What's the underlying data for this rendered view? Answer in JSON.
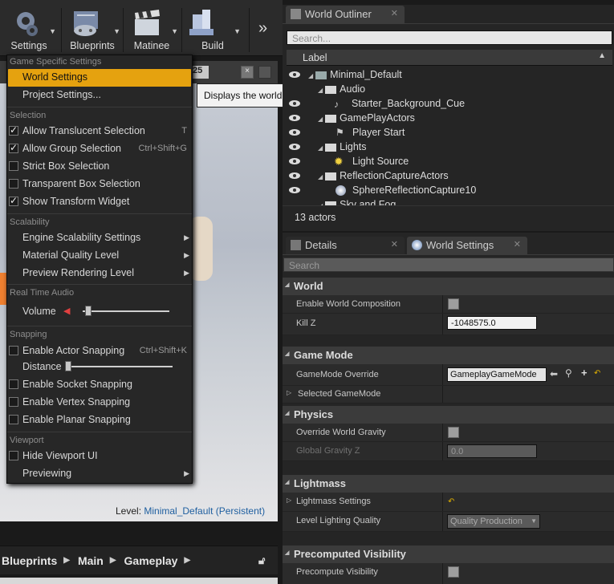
{
  "toolbar": {
    "settings_label": "Settings",
    "blueprints_label": "Blueprints",
    "matinee_label": "Matinee",
    "build_label": "Build",
    "more": "»"
  },
  "viewport": {
    "tab_num": "25",
    "level_label": "Level:",
    "level_value": "Minimal_Default (Persistent)"
  },
  "menu": {
    "section_game": "Game Specific Settings",
    "world_settings": "World Settings",
    "project_settings": "Project Settings...",
    "section_selection": "Selection",
    "allow_translucent": "Allow Translucent Selection",
    "allow_translucent_shortcut": "T",
    "allow_group": "Allow Group Selection",
    "allow_group_shortcut": "Ctrl+Shift+G",
    "strict_box": "Strict Box Selection",
    "transparent_box": "Transparent Box Selection",
    "show_transform": "Show Transform Widget",
    "section_scalability": "Scalability",
    "engine_scalability": "Engine Scalability Settings",
    "material_quality": "Material Quality Level",
    "preview_rendering": "Preview Rendering Level",
    "section_audio": "Real Time Audio",
    "volume": "Volume",
    "volume_level": 0.03,
    "section_snapping": "Snapping",
    "actor_snapping": "Enable Actor Snapping",
    "actor_snapping_shortcut": "Ctrl+Shift+K",
    "distance": "Distance",
    "distance_level": 0.0,
    "socket_snapping": "Enable Socket Snapping",
    "vertex_snapping": "Enable Vertex Snapping",
    "planar_snapping": "Enable Planar Snapping",
    "section_viewport": "Viewport",
    "hide_viewport_ui": "Hide Viewport UI",
    "previewing": "Previewing"
  },
  "tooltip": "Displays the world settings",
  "outliner": {
    "tab": "World Outliner",
    "search_placeholder": "Search...",
    "column_label": "Label",
    "rows": [
      "Minimal_Default",
      "Audio",
      "Starter_Background_Cue",
      "GamePlayActors",
      "Player Start",
      "Lights",
      "Light Source",
      "ReflectionCaptureActors",
      "SphereReflectionCapture10",
      "Sky and Fog"
    ],
    "actor_count": "13 actors"
  },
  "details": {
    "tab_details": "Details",
    "tab_world_settings": "World Settings",
    "search_placeholder": "Search",
    "cat_world": "World",
    "enable_world_composition": "Enable World Composition",
    "kill_z": "Kill Z",
    "kill_z_value": "-1048575.0",
    "cat_game_mode": "Game Mode",
    "gamemode_override": "GameMode Override",
    "gamemode_value": "GameplayGameMode",
    "selected_gamemode": "Selected GameMode",
    "cat_physics": "Physics",
    "override_gravity": "Override World Gravity",
    "global_gravity_z": "Global Gravity Z",
    "global_gravity_value": "0.0",
    "cat_lightmass": "Lightmass",
    "lightmass_settings": "Lightmass Settings",
    "level_lighting_quality": "Level Lighting Quality",
    "lighting_quality_value": "Quality Production",
    "cat_precomputed": "Precomputed Visibility",
    "precompute_visibility": "Precompute Visibility"
  },
  "bottombar": {
    "crumbs": [
      "Blueprints",
      "Main",
      "Gameplay"
    ]
  },
  "colors": {
    "highlight": "#e5a20f",
    "background": "#1a1a1a",
    "panel": "#2b2b2b"
  }
}
